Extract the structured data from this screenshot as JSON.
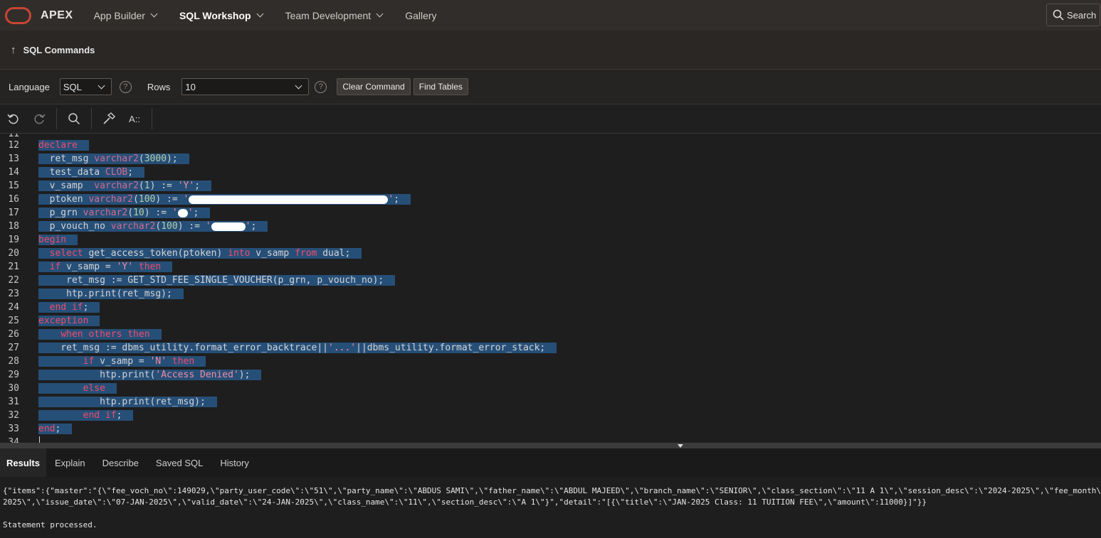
{
  "app": {
    "brand": "APEX",
    "nav": [
      {
        "label": "App Builder",
        "has_menu": true
      },
      {
        "label": "SQL Workshop",
        "has_menu": true,
        "active": true
      },
      {
        "label": "Team Development",
        "has_menu": true
      },
      {
        "label": "Gallery",
        "has_menu": false
      }
    ],
    "search_label": "Search"
  },
  "page": {
    "title": "SQL Commands"
  },
  "options": {
    "language_label": "Language",
    "language_value": "SQL",
    "rows_label": "Rows",
    "rows_value": "10",
    "clear_button": "Clear Command",
    "find_tables_button": "Find Tables",
    "help_glyph": "?"
  },
  "editor_toolbar": {
    "format_label": "A::",
    "icons": [
      "undo-icon",
      "redo-icon",
      "search-icon",
      "hammer-icon",
      "format-icon"
    ]
  },
  "editor": {
    "first_line": 12,
    "lines": [
      "declare",
      "  ret_msg varchar2(3000);",
      "  test_data CLOB;",
      "  v_samp  varchar2(1) := 'Y';",
      "  ptoken varchar2(100) := '[redacted]';",
      "  p_grn varchar2(10) := '[redacted]';",
      "  p_vouch_no varchar2(100) := '[redacted]';",
      "begin",
      "  select get_access_token(ptoken) into v_samp from dual;",
      "  if v_samp = 'Y' then",
      "     ret_msg := GET_STD_FEE_SINGLE_VOUCHER(p_grn, p_vouch_no);",
      "     htp.print(ret_msg);",
      "  end if;",
      "exception",
      "    when others then",
      "    ret_msg := dbms_utility.format_error_backtrace||'...'||dbms_utility.format_error_stack;",
      "        if v_samp = 'N' then",
      "           htp.print('Access Denied');",
      "        else",
      "           htp.print(ret_msg);",
      "        end if;",
      "end;"
    ],
    "partial_top_line": "11",
    "partial_bottom_line": "34"
  },
  "results_tabs": [
    {
      "label": "Results",
      "active": true
    },
    {
      "label": "Explain"
    },
    {
      "label": "Describe"
    },
    {
      "label": "Saved SQL"
    },
    {
      "label": "History"
    }
  ],
  "results": {
    "output_line1": "{\"items\":{\"master\":\"{\\\"fee_voch_no\\\":149029,\\\"party_user_code\\\":\\\"51\\\",\\\"party_name\\\":\\\"ABDUS SAMI\\\",\\\"father_name\\\":\\\"ABDUL MAJEED\\\",\\\"branch_name\\\":\\\"SENIOR\\\",\\\"class_section\\\":\\\"11 A 1\\\",\\\"session_desc\\\":\\\"2024-2025\\\",\\\"fee_month\\\":\\\"JAN-",
    "output_line2": "2025\\\",\\\"issue_date\\\":\\\"07-JAN-2025\\\",\\\"valid_date\\\":\\\"24-JAN-2025\\\",\\\"class_name\\\":\\\"11\\\",\\\"section_desc\\\":\\\"A 1\\\"}\",\"detail\":\"[{\\\"title\\\":\\\"JAN-2025 Class: 11 TUITION FEE\\\",\\\"amount\\\":11000}]\"}}",
    "status": "Statement processed."
  },
  "colors": {
    "brand_red": "#c74634",
    "selection": "#264f78",
    "keyword": "#f14c6b"
  }
}
